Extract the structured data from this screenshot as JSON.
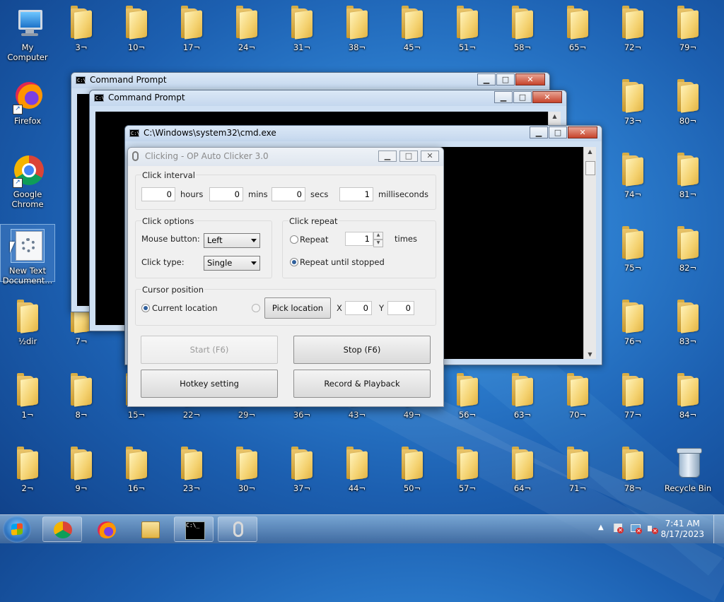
{
  "desktop": {
    "system_icons": {
      "my_computer": "My Computer",
      "firefox": "Firefox",
      "google_chrome": "Google Chrome",
      "new_text_document": "New Text Document...",
      "half_dir": "½dir",
      "recycle_bin": "Recycle Bin"
    },
    "folders": [
      "3¬",
      "10¬",
      "17¬",
      "24¬",
      "31¬",
      "38¬",
      "45¬",
      "51¬",
      "58¬",
      "65¬",
      "72¬",
      "79¬",
      "73¬",
      "80¬",
      "74¬",
      "81¬",
      "75¬",
      "82¬",
      "76¬",
      "83¬",
      "7¬",
      "1¬",
      "8¬",
      "15¬",
      "22¬",
      "29¬",
      "36¬",
      "43¬",
      "49¬",
      "56¬",
      "63¬",
      "70¬",
      "77¬",
      "84¬",
      "2¬",
      "9¬",
      "16¬",
      "23¬",
      "30¬",
      "37¬",
      "44¬",
      "50¬",
      "57¬",
      "64¬",
      "71¬",
      "78¬"
    ]
  },
  "windows": {
    "cmd1": {
      "title": "Command Prompt"
    },
    "cmd2": {
      "title": "Command Prompt"
    },
    "cmd3": {
      "title": "C:\\Windows\\system32\\cmd.exe"
    }
  },
  "clicker": {
    "title": "Clicking - OP Auto Clicker 3.0",
    "click_interval": {
      "label": "Click interval",
      "hours_value": "0",
      "hours_label": "hours",
      "mins_value": "0",
      "mins_label": "mins",
      "secs_value": "0",
      "secs_label": "secs",
      "ms_value": "1",
      "ms_label": "milliseconds"
    },
    "click_options": {
      "label": "Click options",
      "mouse_button_label": "Mouse button:",
      "mouse_button_value": "Left",
      "click_type_label": "Click type:",
      "click_type_value": "Single"
    },
    "click_repeat": {
      "label": "Click repeat",
      "repeat_label": "Repeat",
      "repeat_count": "1",
      "times_label": "times",
      "until_stopped_label": "Repeat until stopped",
      "selected": "until_stopped"
    },
    "cursor_position": {
      "label": "Cursor position",
      "current_location_label": "Current location",
      "pick_location_label": "Pick location",
      "x_label": "X",
      "x_value": "0",
      "y_label": "Y",
      "y_value": "0",
      "selected": "current_location"
    },
    "buttons": {
      "start": "Start (F6)",
      "stop": "Stop (F6)",
      "hotkey": "Hotkey setting",
      "record": "Record & Playback"
    }
  },
  "taskbar": {
    "pinned": [
      "chrome-icon",
      "firefox-icon",
      "explorer-icon",
      "cmd-icon",
      "op-auto-clicker-icon"
    ],
    "clock_time": "7:41 AM",
    "clock_date": "8/17/2023"
  }
}
